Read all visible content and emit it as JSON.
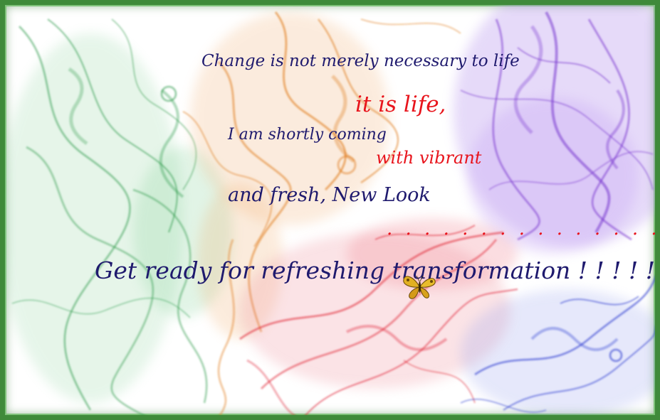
{
  "lines": {
    "line1": "Change is not merely necessary to life",
    "line2": "it is life,",
    "line3": "I am shortly coming",
    "line4": "with vibrant",
    "line5": "and fresh, New Look",
    "line6": ". . . . . . . . . . . . . . .",
    "line7": "Get ready for refreshing transformation ! ! ! ! ! ! !"
  },
  "colors": {
    "navy_text": "#1f1a6e",
    "red_text": "#e8141c",
    "border": "#3f8a3a",
    "smoke_green": "#2f9a4a",
    "smoke_orange": "#e07a1a",
    "smoke_purple": "#7a3ad0",
    "smoke_red": "#e02030",
    "smoke_blue": "#2a3ad0"
  },
  "icons": {
    "butterfly": "butterfly-icon"
  }
}
